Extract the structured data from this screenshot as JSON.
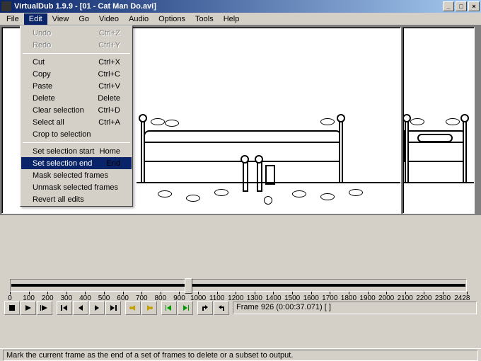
{
  "title": "VirtualDub 1.9.9 - [01 - Cat Man Do.avi]",
  "menubar": [
    "File",
    "Edit",
    "View",
    "Go",
    "Video",
    "Audio",
    "Options",
    "Tools",
    "Help"
  ],
  "menubar_open_index": 1,
  "edit_menu": {
    "groups": [
      [
        {
          "label": "Undo",
          "shortcut": "Ctrl+Z",
          "disabled": true
        },
        {
          "label": "Redo",
          "shortcut": "Ctrl+Y",
          "disabled": true
        }
      ],
      [
        {
          "label": "Cut",
          "shortcut": "Ctrl+X"
        },
        {
          "label": "Copy",
          "shortcut": "Ctrl+C"
        },
        {
          "label": "Paste",
          "shortcut": "Ctrl+V"
        },
        {
          "label": "Delete",
          "shortcut": "Delete"
        },
        {
          "label": "Clear selection",
          "shortcut": "Ctrl+D"
        },
        {
          "label": "Select all",
          "shortcut": "Ctrl+A"
        },
        {
          "label": "Crop to selection",
          "shortcut": ""
        }
      ],
      [
        {
          "label": "Set selection start",
          "shortcut": "Home"
        },
        {
          "label": "Set selection end",
          "shortcut": "End",
          "highlight": true
        },
        {
          "label": "Mask selected frames",
          "shortcut": ""
        },
        {
          "label": "Unmask selected frames",
          "shortcut": ""
        },
        {
          "label": "Revert all edits",
          "shortcut": ""
        }
      ]
    ]
  },
  "timeline": {
    "ticks": [
      0,
      100,
      200,
      300,
      400,
      500,
      600,
      700,
      800,
      900,
      1000,
      1100,
      1200,
      1300,
      1400,
      1500,
      1600,
      1700,
      1800,
      1900,
      2000,
      2100,
      2200,
      2300
    ],
    "max_label": 2428,
    "current": 926
  },
  "frame_info": "Frame 926 (0:00:37.071) [ ]",
  "status": "Mark the current frame as the end of a set of frames to delete or a subset to output."
}
